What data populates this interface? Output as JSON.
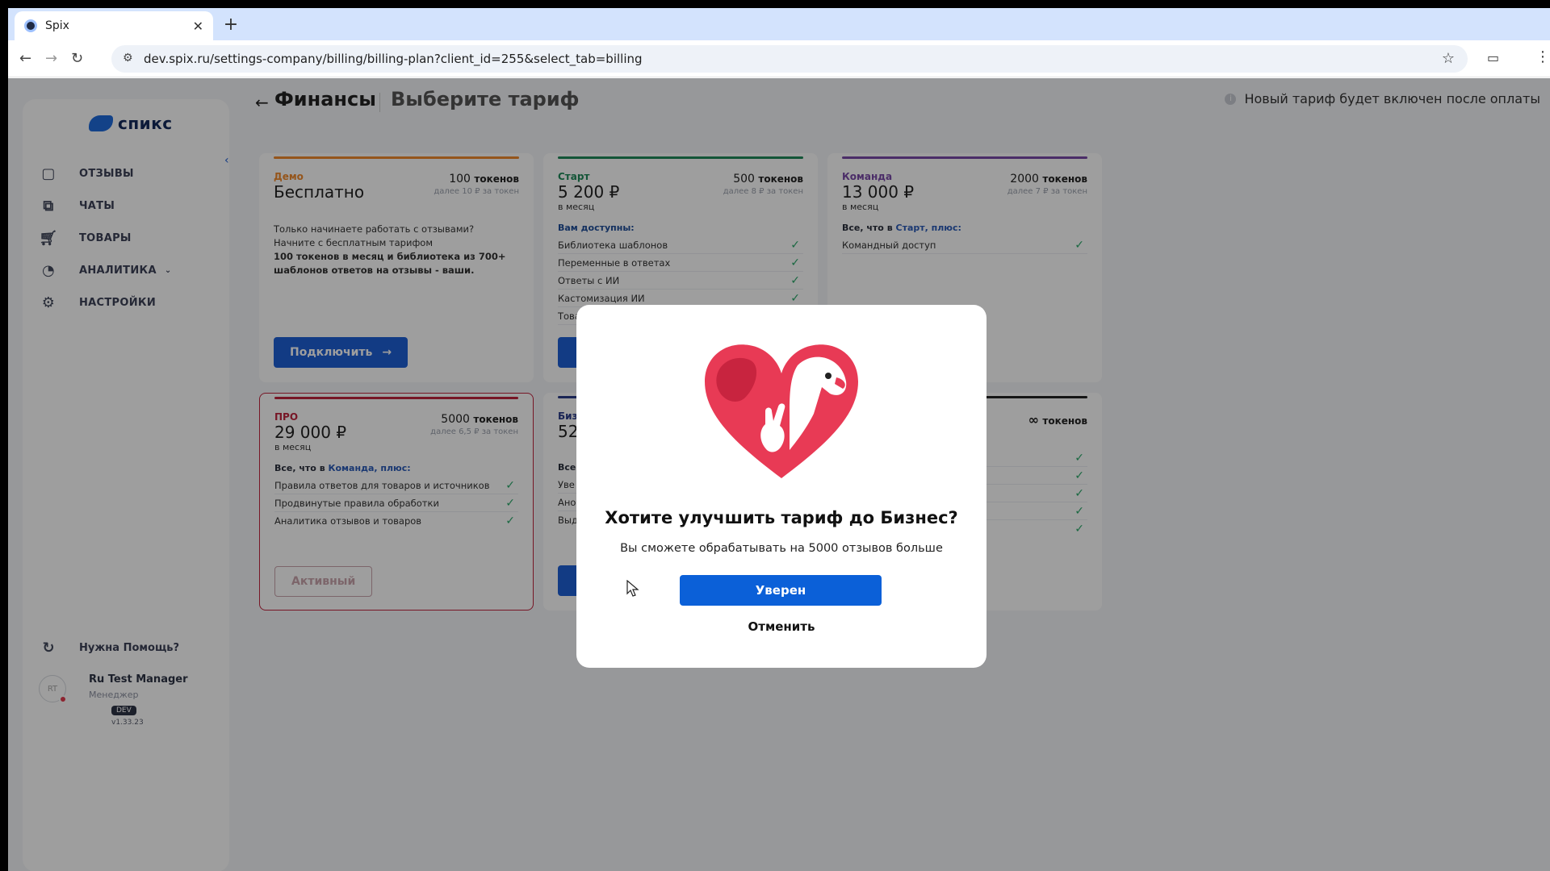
{
  "browser": {
    "tab_title": "Spix",
    "url": "dev.spix.ru/settings-company/billing/billing-plan?client_id=255&select_tab=billing"
  },
  "sidebar": {
    "logo_text": "спикс",
    "items": [
      {
        "label": "ОТЗЫВЫ",
        "icon": "message-square-icon"
      },
      {
        "label": "ЧАТЫ",
        "icon": "chats-icon"
      },
      {
        "label": "ТОВАРЫ",
        "icon": "cart-icon"
      },
      {
        "label": "АНАЛИТИКА",
        "icon": "pie-chart-icon"
      },
      {
        "label": "НАСТРОЙКИ",
        "icon": "gear-icon"
      }
    ],
    "help": "Нужна Помощь?",
    "user": {
      "initials": "RT",
      "name": "Ru Test Manager",
      "role": "Менеджер"
    },
    "env_badge": "DEV",
    "version": "v1.33.23"
  },
  "header": {
    "title": "Финансы",
    "subtitle": "Выберите тариф",
    "notice": "Новый тариф будет включен после оплаты"
  },
  "plans": {
    "demo": {
      "name": "Демо",
      "price": "Бесплатно",
      "tokens": "100",
      "tokens_unit": "токенов",
      "after": "далее 10 ₽ за токен",
      "desc": "Только начинаете работать с отзывами? Начните с бесплатным тарифом",
      "desc_bold": "100 токенов в месяц и библиотека из 700+ шаблонов ответов на отзывы - ваши.",
      "button": "Подключить"
    },
    "start": {
      "name": "Старт",
      "price": "5 200 ₽",
      "per": "в месяц",
      "tokens": "500",
      "tokens_unit": "токенов",
      "after": "далее 8 ₽ за токен",
      "lead": "Вам доступны:",
      "features": [
        "Библиотека шаблонов",
        "Переменные в ответах",
        "Ответы с ИИ",
        "Кастомизация ИИ",
        "Това"
      ]
    },
    "team": {
      "name": "Команда",
      "price": "13 000 ₽",
      "per": "в месяц",
      "tokens": "2000",
      "tokens_unit": "токенов",
      "after": "далее 7 ₽ за токен",
      "lead_prefix": "Все, что в",
      "lead_link": "Старт, плюс:",
      "features": [
        "Командный доступ"
      ]
    },
    "pro": {
      "name": "ПРО",
      "price": "29 000 ₽",
      "per": "в месяц",
      "tokens": "5000",
      "tokens_unit": "токенов",
      "after": "далее 6,5 ₽ за токен",
      "lead_prefix": "Все, что в",
      "lead_link": "Команда, плюс:",
      "features": [
        "Правила ответов для товаров и источников",
        "Продвинутые правила обработки",
        "Аналитика отзывов и товаров"
      ],
      "button": "Активный"
    },
    "business": {
      "name": "Биз",
      "price": "52",
      "lead": "Все",
      "features": [
        "Уве",
        "Ано",
        "Выд"
      ]
    },
    "enterprise": {
      "tokens_symbol": "∞",
      "tokens_unit": "токенов"
    }
  },
  "modal": {
    "title": "Хотите улучшить тариф до Бизнес?",
    "subtitle": "Вы сможете обрабатывать на 5000 отзывов больше",
    "confirm": "Уверен",
    "cancel": "Отменить"
  },
  "colors": {
    "demo": "#f08a2c",
    "start": "#1f8a5a",
    "team": "#7a4aa8",
    "pro": "#c0243e",
    "business": "#2a3c8a",
    "enterprise": "#222222",
    "primary": "#1e5fd6"
  }
}
